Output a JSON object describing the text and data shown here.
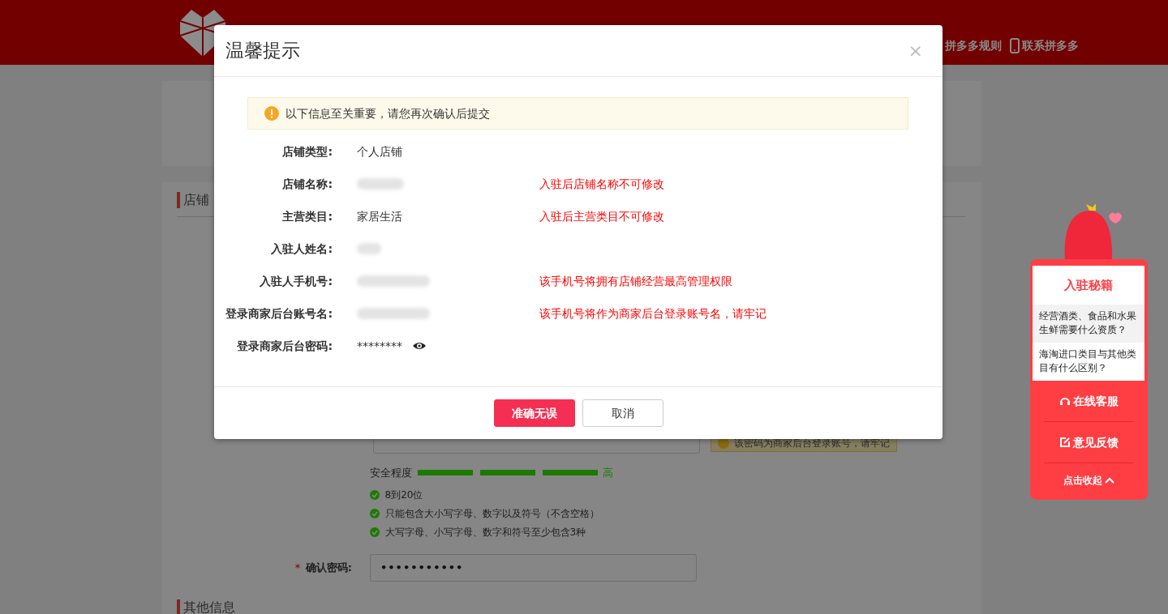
{
  "header": {
    "links": [
      {
        "label": "拼多多规则",
        "has_icon": false
      },
      {
        "label": "联系拼多多",
        "has_icon": true
      }
    ]
  },
  "section": {
    "title": "店铺"
  },
  "password": {
    "hint": "该密码为商家后台登录账号，请牢记",
    "strength_label": "安全程度",
    "segments": [
      {
        "on": true
      },
      {
        "on": true
      },
      {
        "on": true
      }
    ],
    "strength_text": "高",
    "rules": [
      {
        "text": "8到20位",
        "met": true
      },
      {
        "text": "只能包含大小写字母、数字以及符号（不含空格）",
        "met": true
      },
      {
        "text": "大写字母、小写字母、数字和符号至少包含3种",
        "met": true
      }
    ]
  },
  "confirm": {
    "label": "确认密码:",
    "required_mark": "*",
    "value": "•••••••••••"
  },
  "other_section": {
    "title": "其他信息"
  },
  "modal": {
    "title": "温馨提示",
    "close": "×",
    "notice": "以下信息至关重要，请您再次确认后提交",
    "fields": [
      {
        "label": "店铺类型:",
        "kind": "text",
        "value": "个人店铺"
      },
      {
        "label": "店铺名称:",
        "kind": "blurred",
        "warning": "入驻后店铺名称不可修改"
      },
      {
        "label": "主营类目:",
        "kind": "text",
        "value": "家居生活",
        "warning": "入驻后主营类目不可修改"
      },
      {
        "label": "入驻人姓名:",
        "kind": "blurred"
      },
      {
        "label": "入驻人手机号:",
        "kind": "blurred",
        "warning": "该手机号将拥有店铺经营最高管理权限"
      },
      {
        "label": "登录商家后台账号名:",
        "kind": "blurred",
        "warning": "该手机号将作为商家后台登录账号名，请牢记"
      },
      {
        "label": "登录商家后台密码:",
        "kind": "password",
        "value": "********"
      }
    ],
    "buttons": [
      {
        "label": "准确无误",
        "primary": true
      },
      {
        "label": "取消",
        "primary": false
      }
    ]
  },
  "side_panel": {
    "title": "入驻秘籍",
    "questions": [
      {
        "text": "经营酒类、食品和水果生鲜需要什么资质？",
        "hovered": true
      },
      {
        "text": "海淘进口类目与其他类目有什么区别？",
        "hovered": false
      }
    ],
    "actions": [
      {
        "label": "在线客服",
        "kind": "service"
      },
      {
        "label": "意见反馈",
        "kind": "feedback"
      }
    ],
    "collapse": "点击收起"
  }
}
